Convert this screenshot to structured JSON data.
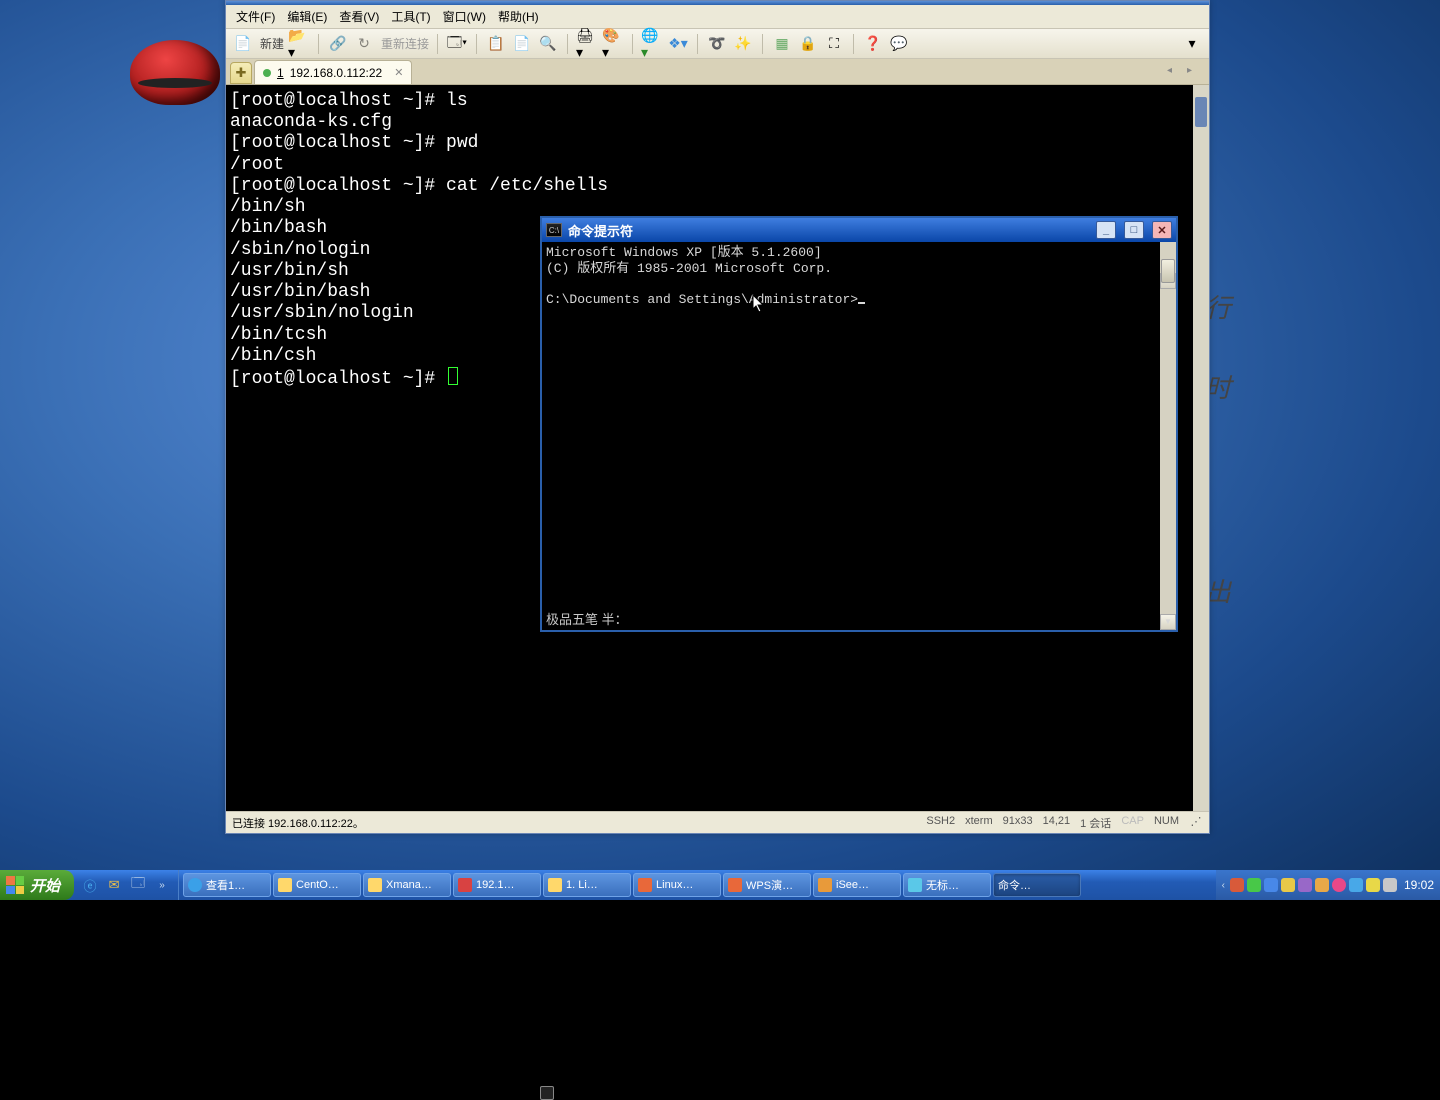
{
  "menubar": {
    "file": "文件(F)",
    "edit": "编辑(E)",
    "view": "查看(V)",
    "tools": "工具(T)",
    "window": "窗口(W)",
    "help": "帮助(H)"
  },
  "toolbar": {
    "new_label": "新建",
    "reconnect_label": "重新连接"
  },
  "tab": {
    "index": "1",
    "label": "192.168.0.112:22"
  },
  "terminal": {
    "lines": [
      "[root@localhost ~]# ls",
      "anaconda-ks.cfg",
      "[root@localhost ~]# pwd",
      "/root",
      "[root@localhost ~]# cat /etc/shells",
      "/bin/sh",
      "/bin/bash",
      "/sbin/nologin",
      "/usr/bin/sh",
      "/usr/bin/bash",
      "/usr/sbin/nologin",
      "/bin/tcsh",
      "/bin/csh",
      "[root@localhost ~]# "
    ]
  },
  "statusbar": {
    "left": "已连接 192.168.0.112:22。",
    "proto": "SSH2",
    "term": "xterm",
    "size": "91x33",
    "pos": "14,21",
    "sess": "1 会话",
    "cap": "CAP",
    "num": "NUM"
  },
  "cmd": {
    "title": "命令提示符",
    "lines": [
      "Microsoft Windows XP [版本 5.1.2600]",
      "(C) 版权所有 1985-2001 Microsoft Corp.",
      "",
      "C:\\Documents and Settings\\Administrator>"
    ],
    "ime": "极品五笔 半："
  },
  "taskbar": {
    "start": "开始",
    "tasks": [
      {
        "label": "查看1…",
        "icon": "ie"
      },
      {
        "label": "CentO…",
        "icon": "folder"
      },
      {
        "label": "Xmana…",
        "icon": "folder"
      },
      {
        "label": "192.1…",
        "icon": "red"
      },
      {
        "label": "1. Li…",
        "icon": "folder"
      },
      {
        "label": "Linux…",
        "icon": "wps"
      },
      {
        "label": "WPS演…",
        "icon": "wps"
      },
      {
        "label": "iSee…",
        "icon": "orange"
      },
      {
        "label": "无标…",
        "icon": "paint"
      },
      {
        "label": "命令…",
        "icon": "cmd",
        "active": true
      }
    ],
    "clock": "19:02"
  },
  "side_text": {
    "t1": "行",
    "t2": "时",
    "t3": "出"
  }
}
